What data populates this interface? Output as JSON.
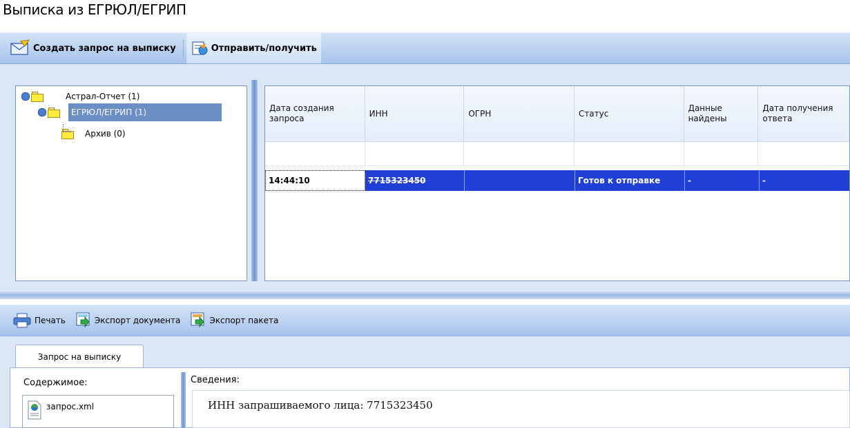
{
  "window": {
    "title": "Выписка из ЕГРЮЛ/ЕГРИП"
  },
  "toolbar": {
    "create_label": "Создать запрос на выписку",
    "send_label": "Отправить/получить"
  },
  "tree": {
    "items": [
      {
        "label": "Астрал-Отчет (1)"
      },
      {
        "label": "ЕГРЮЛ/ЕГРИП (1)"
      },
      {
        "label": "Архив (0)"
      }
    ]
  },
  "grid": {
    "headers": [
      "Дата создания запроса",
      "ИНН",
      "ОГРН",
      "Статус",
      "Данные найдены",
      "Дата получения ответа"
    ],
    "rows": [
      {
        "date": "14:44:10",
        "inn": "7715323450",
        "ogrn": "",
        "status": "Готов к отправке",
        "found": "-",
        "answer_date": "-"
      }
    ]
  },
  "bottom_toolbar": {
    "print_label": "Печать",
    "export_doc_label": "Экспорт документа",
    "export_pkg_label": "Экспорт пакета"
  },
  "tabs": {
    "request": "Запрос на выписку"
  },
  "content": {
    "label": "Содержимое:",
    "file": "запрос.xml"
  },
  "details": {
    "label": "Сведения:",
    "text": "ИНН запрашиваемого лица: 7715323450"
  },
  "colors": {
    "selection": "#1f3fd6",
    "toolbar": "#a6c3ea",
    "tree_selection": "#6b8fc5"
  }
}
